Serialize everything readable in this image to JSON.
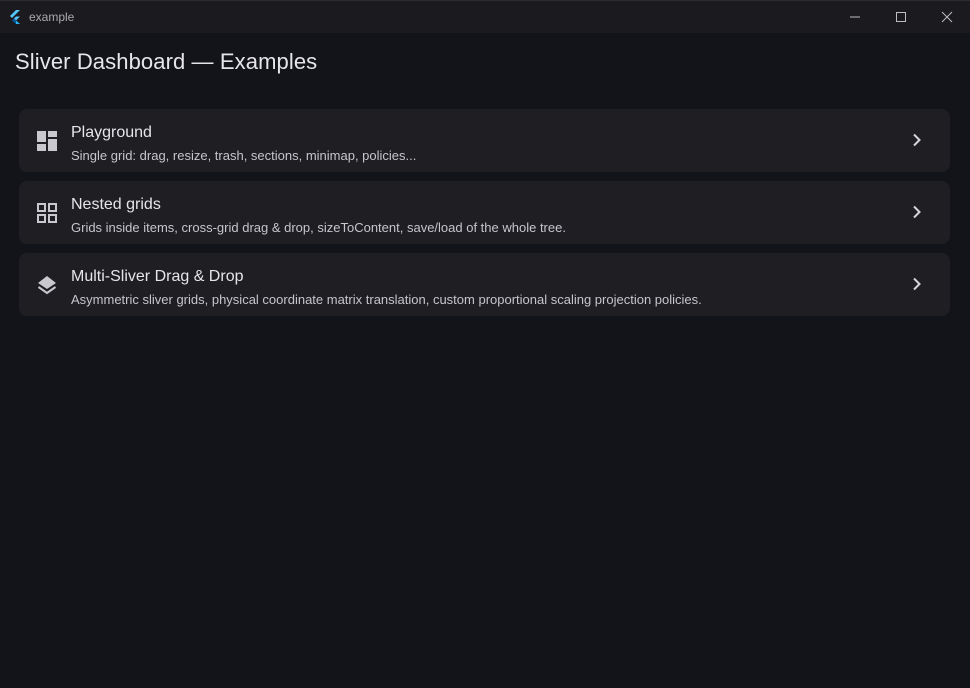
{
  "window": {
    "title": "example",
    "controls": [
      "minimize-icon",
      "maximize-icon",
      "close-icon"
    ]
  },
  "page": {
    "title": "Sliver Dashboard — Examples"
  },
  "examples": [
    {
      "icon": "dashboard-icon",
      "title": "Playground",
      "subtitle": "Single grid: drag, resize, trash, sections, minimap, policies..."
    },
    {
      "icon": "grid-view-icon",
      "title": "Nested grids",
      "subtitle": "Grids inside items, cross-grid drag & drop, sizeToContent, save/load of the whole tree."
    },
    {
      "icon": "layers-icon",
      "title": "Multi-Sliver Drag & Drop",
      "subtitle": "Asymmetric sliver grids, physical coordinate matrix translation, custom proportional scaling projection policies."
    }
  ],
  "colors": {
    "background": "#131419",
    "titlebar": "#1b1b1f",
    "card": "#1e1e23",
    "text_primary": "#e6e5ea",
    "text_secondary": "#c6c5cc",
    "flutter_blue_light": "#54c5f8",
    "flutter_blue_dark": "#01579b"
  }
}
